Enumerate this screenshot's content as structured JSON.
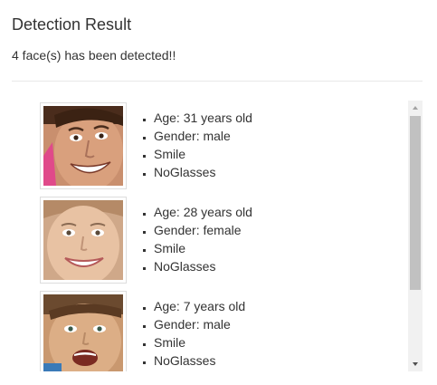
{
  "header": {
    "title": "Detection Result",
    "status": "4 face(s) has been detected!!"
  },
  "faces": [
    {
      "thumbnail": "face-photo",
      "attributes": [
        "Age: 31 years old",
        "Gender: male",
        "Smile",
        "NoGlasses"
      ]
    },
    {
      "thumbnail": "face-photo",
      "attributes": [
        "Age: 28 years old",
        "Gender: female",
        "Smile",
        "NoGlasses"
      ]
    },
    {
      "thumbnail": "face-photo",
      "attributes": [
        "Age: 7 years old",
        "Gender: male",
        "Smile",
        "NoGlasses"
      ]
    }
  ],
  "scrollbar": {
    "position": 0.0,
    "visible_fraction": 0.73
  }
}
